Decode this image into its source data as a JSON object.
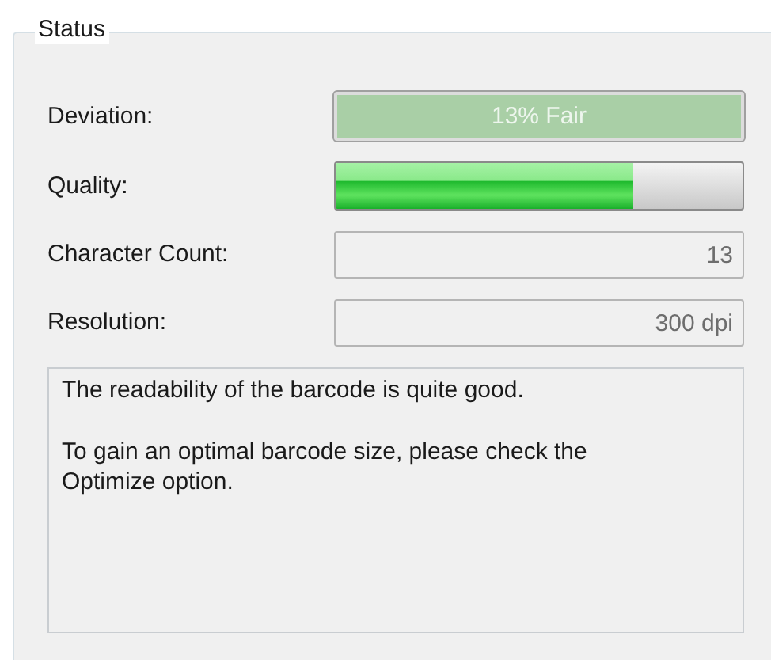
{
  "group": {
    "title": "Status",
    "rows": [
      {
        "kind": "rating",
        "label": "Deviation:",
        "value": "13% Fair"
      },
      {
        "kind": "meter",
        "label": "Quality:",
        "level": 0.73
      },
      {
        "kind": "readout",
        "label": "Character Count:",
        "value": "13"
      },
      {
        "kind": "readout",
        "label": "Resolution:",
        "value": "300 dpi"
      }
    ],
    "message": [
      "The readability of the barcode is quite good.",
      "To gain an optimal barcode size, please check the Optimize option."
    ]
  }
}
